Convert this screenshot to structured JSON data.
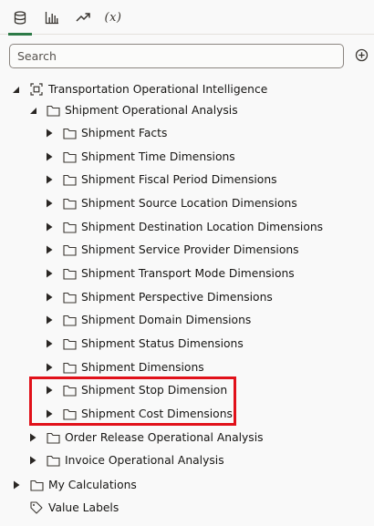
{
  "tabs": [
    {
      "name": "data-elements",
      "icon": "database-icon",
      "active": true
    },
    {
      "name": "visualizations",
      "icon": "bar-chart-icon",
      "active": false
    },
    {
      "name": "analytics",
      "icon": "trend-icon",
      "active": false
    },
    {
      "name": "calculations",
      "icon": "fx-icon",
      "label": "(x)",
      "active": false
    }
  ],
  "search": {
    "placeholder": "Search"
  },
  "tree": {
    "root": "Transportation Operational Intelligence",
    "shipment_folder": "Shipment Operational Analysis",
    "shipment_items": [
      "Shipment Facts",
      "Shipment Time Dimensions",
      "Shipment Fiscal Period Dimensions",
      "Shipment Source Location Dimensions",
      "Shipment Destination Location Dimensions",
      "Shipment Service Provider Dimensions",
      "Shipment Transport Mode Dimensions",
      "Shipment Perspective Dimensions",
      "Shipment Domain Dimensions",
      "Shipment Status Dimensions",
      "Shipment Dimensions",
      "Shipment Stop Dimension",
      "Shipment Cost Dimensions"
    ],
    "other_folders": [
      "Order Release Operational Analysis",
      "Invoice Operational Analysis"
    ],
    "my_calculations": "My Calculations",
    "value_labels": "Value Labels"
  },
  "colors": {
    "accent": "#2d7a47",
    "highlight_border": "#e1111a"
  }
}
